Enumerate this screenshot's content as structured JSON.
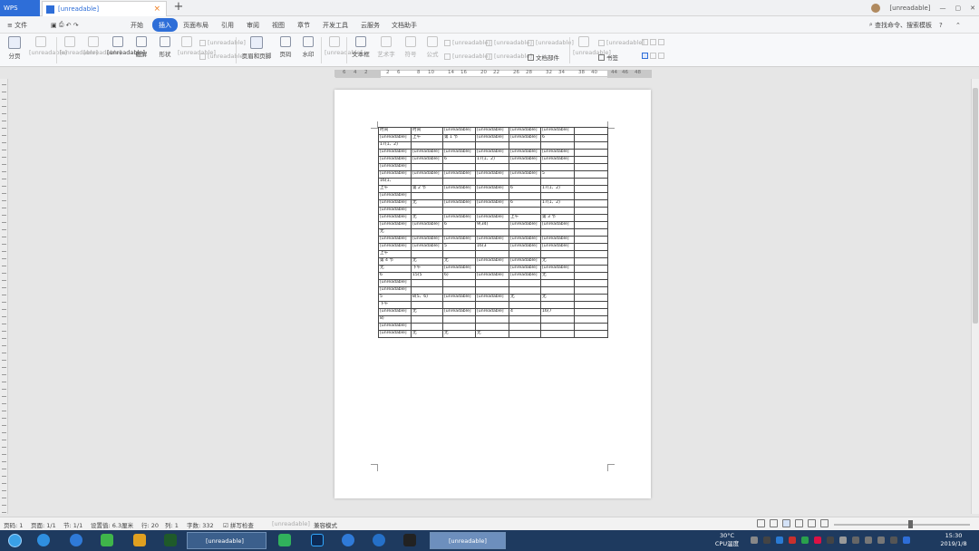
{
  "app": {
    "tab_label": "WPS",
    "doc_tab_title": "[unreadable]",
    "close": "×",
    "add": "+"
  },
  "window": {
    "user_name": "[unreadable]"
  },
  "menu": {
    "file": "文件",
    "items": [
      "开始",
      "插入",
      "页面布局",
      "引用",
      "审阅",
      "视图",
      "章节",
      "开发工具",
      "云服务",
      "文档助手"
    ],
    "active": "插入",
    "search": "查找命令、搜索模板",
    "help": "?"
  },
  "ribbon": {
    "groups": [
      "分页",
      "[unreadable]",
      "[unreadable]",
      "[unreadable]",
      "[unreadable]",
      "截屏",
      "形状",
      "[unreadable]",
      "[unreadable]",
      "页眉和页脚",
      "页码",
      "水印",
      "[unreadable]",
      "文本框",
      "艺术字",
      "符号",
      "公式"
    ],
    "small": [
      "[unreadable]",
      "[unreadable]",
      "[unreadable]",
      "[unreadable]",
      "[unreadable]",
      "[unreadable]",
      "[unreadable]",
      "[unreadable]"
    ],
    "doc_parts": "文档部件",
    "right": [
      "[unreadable]",
      "书签"
    ]
  },
  "ruler": {
    "ticks": [
      "6",
      "4",
      "2",
      "2",
      "6",
      "8",
      "10",
      "14",
      "16",
      "20",
      "22",
      "26",
      "28",
      "32",
      "34",
      "38",
      "40",
      "44",
      "46",
      "48"
    ]
  },
  "document": {
    "rows": [
      [
        "时间",
        "时间",
        "[unreadable]",
        "[unreadable]",
        "[unreadable]",
        "[unreadable]",
        ""
      ],
      [
        "[unreadable]",
        "上午",
        "第 1 节",
        "[unreadable]",
        "[unreadable]",
        "6",
        ""
      ],
      [
        "17(1、2)",
        "",
        "",
        "",
        "",
        "",
        ""
      ],
      [
        "[unreadable]",
        "[unreadable]",
        "[unreadable]",
        "[unreadable]",
        "[unreadable]",
        "[unreadable]",
        ""
      ],
      [
        "[unreadable]",
        "[unreadable]",
        "6",
        "17(1、2)",
        "[unreadable]",
        "[unreadable]",
        ""
      ],
      [
        "[unreadable]",
        "",
        "",
        "",
        "",
        "",
        ""
      ],
      [
        "[unreadable]",
        "[unreadable]",
        "[unreadable]",
        "[unreadable]",
        "[unreadable]",
        "5",
        ""
      ],
      [
        "16(1、",
        "",
        "",
        "",
        "",
        "",
        ""
      ],
      [
        "上午",
        "第 2 节",
        "[unreadable]",
        "[unreadable]",
        "6",
        "17(1、2)",
        ""
      ],
      [
        "[unreadable]",
        "",
        "",
        "",
        "",
        "",
        ""
      ],
      [
        "[unreadable]",
        "无",
        "[unreadable]",
        "[unreadable]",
        "6",
        "17(1、2)",
        ""
      ],
      [
        "[unreadable]",
        "",
        "",
        "",
        "",
        "",
        ""
      ],
      [
        "[unreadable]",
        "无",
        "[unreadable]",
        "[unreadable]",
        "上午",
        "第 3 节",
        ""
      ],
      [
        "[unreadable]",
        "[unreadable]",
        "6",
        "9(34)",
        "[unreadable]",
        "[unreadable]",
        ""
      ],
      [
        "无",
        "",
        "",
        "",
        "",
        "",
        ""
      ],
      [
        "[unreadable]",
        "[unreadable]",
        "[unreadable]",
        "[unreadable]",
        "[unreadable]",
        "[unreadable]",
        ""
      ],
      [
        "[unreadable]",
        "[unreadable]",
        "5",
        "16(3",
        "[unreadable]",
        "[unreadable]",
        ""
      ],
      [
        "上午",
        "",
        "",
        "",
        "",
        "",
        ""
      ],
      [
        "第 4 节",
        "无",
        "无",
        "[unreadable]",
        "[unreadable]",
        "无",
        ""
      ],
      [
        "无",
        "下午",
        "[unreadable]",
        "",
        "[unreadable]",
        "[unreadable]",
        ""
      ],
      [
        "6",
        "15(5",
        "6)",
        "[unreadable]",
        "[unreadable]",
        "无",
        ""
      ],
      [
        "[unreadable]",
        "",
        "",
        "",
        "",
        "",
        ""
      ],
      [
        "[unreadable]",
        "",
        "",
        "",
        "",
        "",
        ""
      ],
      [
        "5",
        "8(5、6)",
        "[unreadable]",
        "[unreadable]",
        "无",
        "无",
        ""
      ],
      [
        "下午",
        "",
        "",
        "",
        "",
        "",
        ""
      ],
      [
        "[unreadable]",
        "无",
        "[unreadable]",
        "[unreadable]",
        "4",
        "16(7",
        ""
      ],
      [
        "8)",
        "",
        "",
        "",
        "",
        "",
        ""
      ],
      [
        "[unreadable]",
        "",
        "",
        "",
        "",
        "",
        ""
      ],
      [
        "[unreadable]",
        "无",
        "无",
        "无",
        "",
        "",
        ""
      ]
    ]
  },
  "status": {
    "page_no": "页码: 1",
    "pages": "页面: 1/1",
    "section": "节: 1/1",
    "setting": "设置值: 6.3厘米",
    "row": "行: 20",
    "col": "列: 1",
    "words": "字数: 332",
    "spell": "拼写检查",
    "revise": "[unreadable]",
    "compat": "兼容模式"
  },
  "taskbar": {
    "windows": [
      {
        "label": "[unreadable]",
        "active": false
      },
      {
        "label": "[unreadable]",
        "active": true
      }
    ],
    "weather": "30°C",
    "weather_label": "CPU温度",
    "time": "15:30",
    "date": "2019/1/8"
  }
}
